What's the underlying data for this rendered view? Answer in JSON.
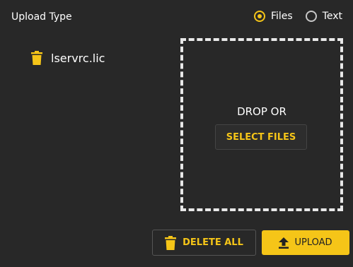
{
  "header": {
    "upload_type_label": "Upload Type"
  },
  "upload_type": {
    "options": [
      {
        "label": "Files",
        "selected": true
      },
      {
        "label": "Text",
        "selected": false
      }
    ]
  },
  "files": [
    {
      "name": "lservrc.lic",
      "icon": "trash-icon"
    }
  ],
  "drop_zone": {
    "text": "DROP OR",
    "select_button_label": "SELECT FILES"
  },
  "actions": {
    "delete_all_label": "DELETE ALL",
    "delete_all_icon": "trash-icon",
    "upload_label": "UPLOAD",
    "upload_icon": "upload-icon"
  },
  "colors": {
    "background": "#282828",
    "accent": "#f5c518",
    "text": "#ffffff",
    "border": "#e8e8e8"
  }
}
